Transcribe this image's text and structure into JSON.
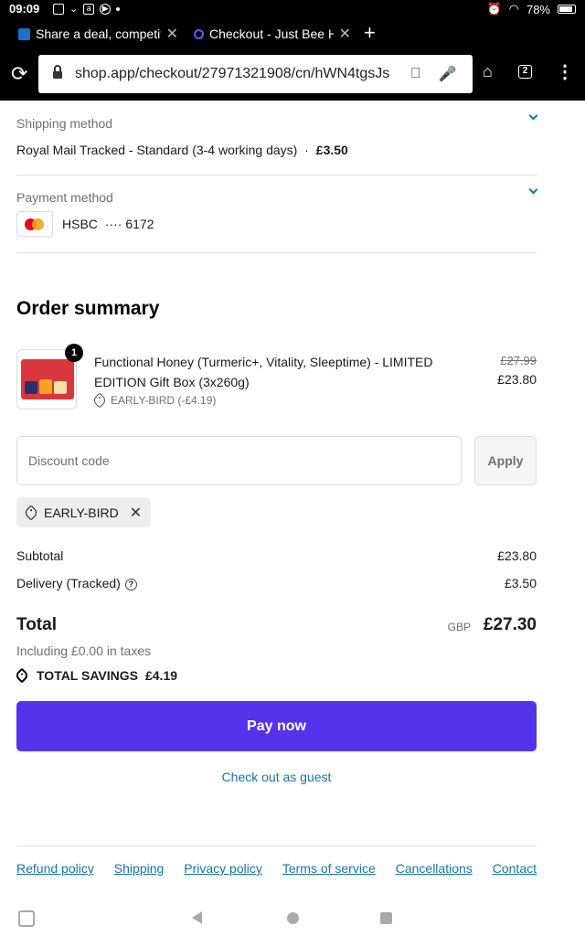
{
  "status_bar": {
    "time": "09:09",
    "battery": "78%",
    "battery_level": 0.78
  },
  "tabs": [
    {
      "title": "Share a deal, competit",
      "icon": "hotukdeals-favicon",
      "color": "#1a73c9"
    },
    {
      "title": "Checkout - Just Bee Ho",
      "icon": "shop-favicon",
      "color": "#5433eb"
    }
  ],
  "address_bar": {
    "url": "shop.app/checkout/27971321908/cn/hWN4tgsJs",
    "tab_count": "2"
  },
  "shipping": {
    "label": "Shipping method",
    "method": "Royal Mail Tracked - Standard (3-4 working days)",
    "separator": "·",
    "price": "£3.50"
  },
  "payment": {
    "label": "Payment method",
    "bank": "HSBC",
    "dots": "····",
    "last4": "6172"
  },
  "order_summary": {
    "title": "Order summary",
    "item": {
      "quantity": "1",
      "name": "Functional Honey (Turmeric+, Vitality, Sleeptime) - LIMITED EDITION Gift Box (3x260g)",
      "discount": "EARLY-BIRD (-£4.19)",
      "old_price": "£27.99",
      "new_price": "£23.80"
    },
    "discount_placeholder": "Discount code",
    "apply_label": "Apply",
    "applied_code": "EARLY-BIRD",
    "subtotal_label": "Subtotal",
    "subtotal_value": "£23.80",
    "delivery_label": "Delivery (Tracked)",
    "delivery_value": "£3.50",
    "total_label": "Total",
    "currency": "GBP",
    "total_value": "£27.30",
    "taxes": "Including £0.00 in taxes",
    "savings_label": "TOTAL SAVINGS",
    "savings_value": "£4.19"
  },
  "actions": {
    "pay_now": "Pay now",
    "guest": "Check out as guest"
  },
  "footer_links": [
    "Refund policy",
    "Shipping",
    "Privacy policy",
    "Terms of service",
    "Cancellations",
    "Contact"
  ],
  "colors": {
    "accent": "#5433eb",
    "link": "#1773b0"
  }
}
